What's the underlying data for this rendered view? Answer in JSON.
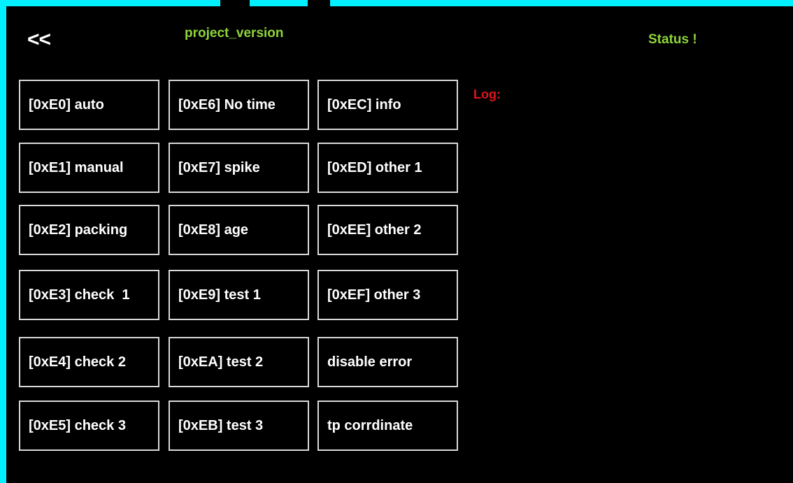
{
  "header": {
    "back_label": "<<",
    "project_version": "project_version",
    "status": "Status !"
  },
  "log": {
    "label": "Log:"
  },
  "commands": [
    [
      "[0xE0] auto",
      "[0xE6] No time",
      "[0xEC] info"
    ],
    [
      "[0xE1] manual",
      "[0xE7] spike",
      "[0xED] other 1"
    ],
    [
      "[0xE2] packing",
      "[0xE8] age",
      "[0xEE] other 2"
    ],
    [
      "[0xE3] check  1",
      "[0xE9] test 1",
      "[0xEF] other 3"
    ],
    [
      "[0xE4] check 2",
      "[0xEA] test 2",
      "disable error"
    ],
    [
      "[0xE5] check 3",
      "[0xEB] test 3",
      "tp corrdinate"
    ]
  ],
  "colors": {
    "frame": "#00f0ff",
    "background": "#000000",
    "title_green": "#8fd53a",
    "log_red": "#e0151c",
    "button_border": "#d9d9d9",
    "button_text": "#ffffff"
  }
}
